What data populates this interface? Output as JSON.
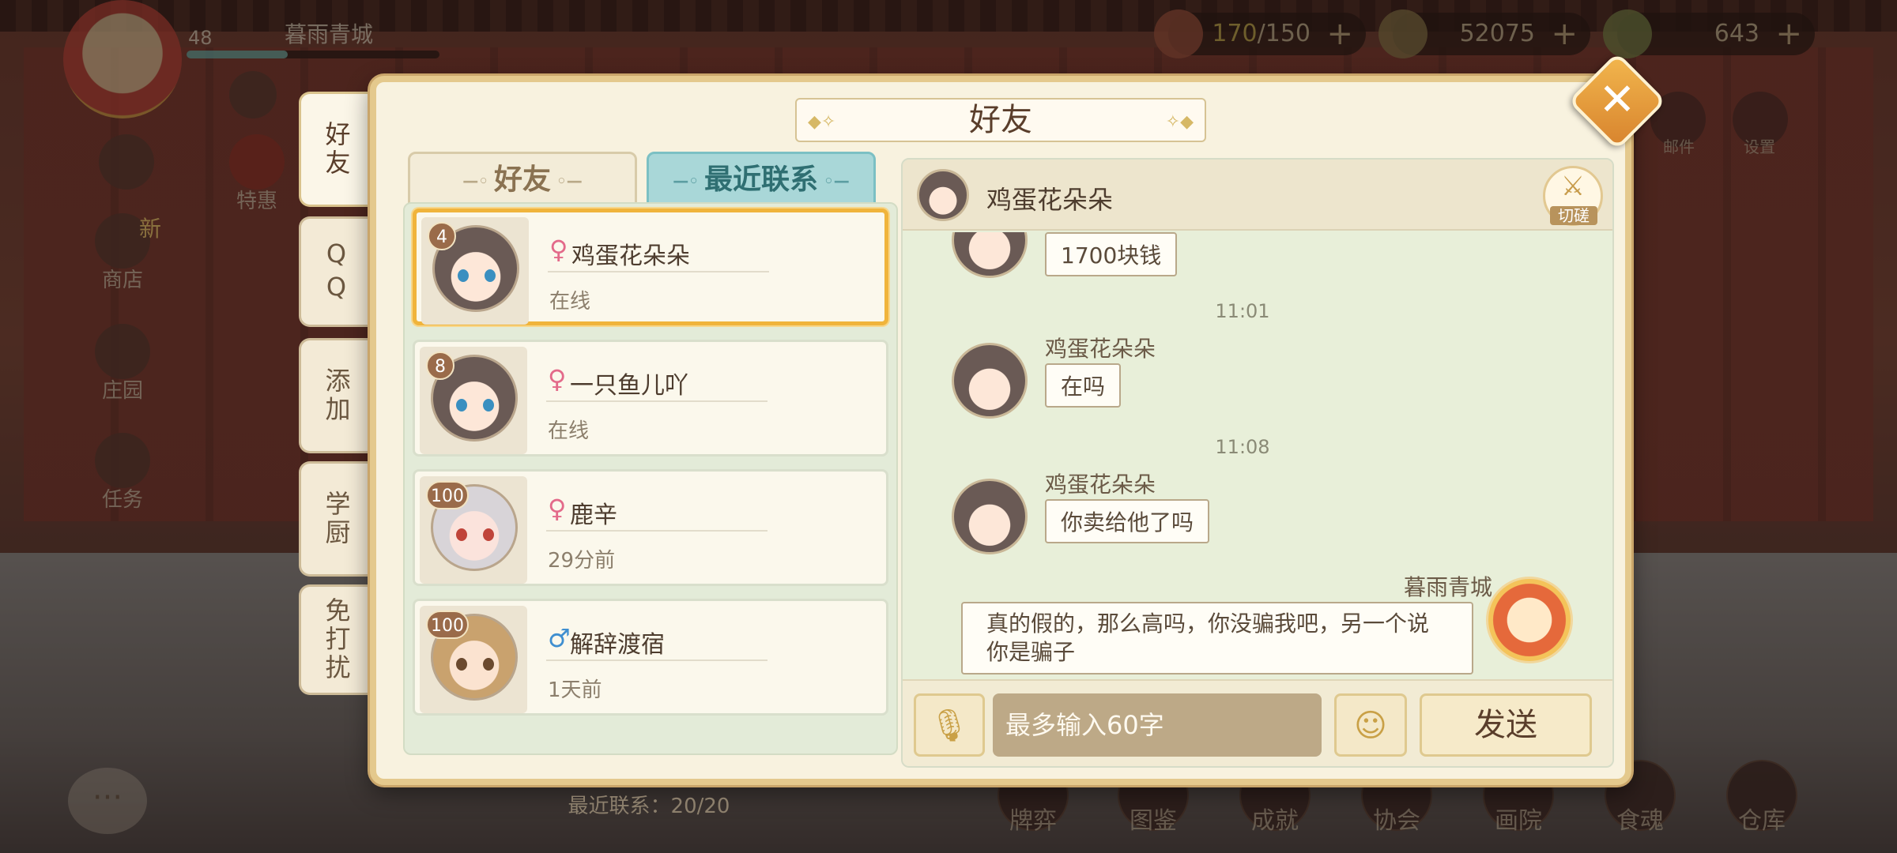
{
  "hud": {
    "level": "48",
    "player_name": "暮雨青城",
    "stamina": {
      "current": "170",
      "max": "/150",
      "icon": "bowl-icon"
    },
    "coins": {
      "value": "52075",
      "icon": "coin-icon"
    },
    "gems": {
      "value": "643",
      "icon": "gem-icon"
    },
    "plus": "+",
    "top_labels": {
      "mail": "邮件",
      "settings": "设置"
    }
  },
  "side_menu": [
    {
      "label": "商店",
      "badge": "新"
    },
    {
      "label": "庄园"
    },
    {
      "label": "任务"
    }
  ],
  "special_label": "特惠",
  "bottom_menu": [
    "牌弈",
    "图鉴",
    "成就",
    "协会",
    "画院",
    "食魂",
    "仓库"
  ],
  "dialog": {
    "title": "好友",
    "close_label": "✕",
    "vertical_tabs": [
      {
        "label": "好友",
        "active": true
      },
      {
        "label": "QQ",
        "active": false
      },
      {
        "label": "添加",
        "active": false
      },
      {
        "label": "学厨",
        "active": false
      },
      {
        "label": "免打扰",
        "active": false
      }
    ],
    "segments": {
      "friends": "好友",
      "recent": "最近联系"
    },
    "friends": [
      {
        "badge": "4",
        "gender": "♀",
        "name": "鸡蛋花朵朵",
        "status": "在线",
        "selected": true
      },
      {
        "badge": "8",
        "gender": "♀",
        "name": "一只鱼儿吖",
        "status": "在线",
        "selected": false
      },
      {
        "badge": "100",
        "gender": "♀",
        "name": "鹿辛",
        "status": "29分前",
        "selected": false
      },
      {
        "badge": "100",
        "gender": "♂",
        "name": "解辞渡宿",
        "status": "1天前",
        "selected": false
      }
    ],
    "recent_count": "最近联系：20/20",
    "chat": {
      "partner_name": "鸡蛋花朵朵",
      "duel_label": "切磋",
      "messages": [
        {
          "text": "1700块钱"
        },
        {
          "time": "11:01",
          "sender": "鸡蛋花朵朵",
          "text": "在吗"
        },
        {
          "time": "11:08",
          "sender": "鸡蛋花朵朵",
          "text": "你卖给他了吗"
        }
      ],
      "my_name": "暮雨青城",
      "my_message": "真的假的，那么高吗，你没骗我吧，另一个说你是骗子",
      "input_placeholder": "最多输入60字",
      "send_label": "发送"
    }
  }
}
